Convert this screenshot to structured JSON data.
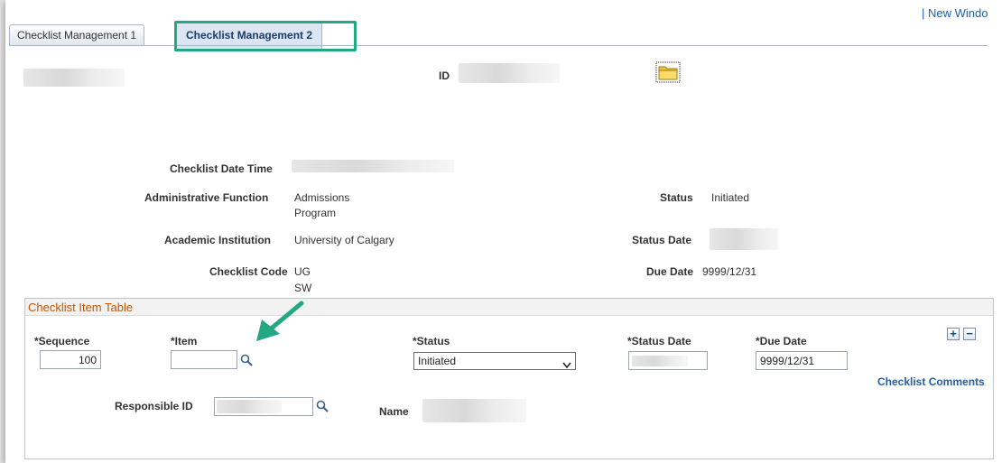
{
  "top_link": "| New Windo",
  "tabs": [
    {
      "label": "Checklist Management 1"
    },
    {
      "label": "Checklist Management 2"
    }
  ],
  "header": {
    "id_label": "ID",
    "folder_icon": "folder-icon"
  },
  "details": {
    "checklist_datetime_label": "Checklist Date Time",
    "admin_function_label": "Administrative Function",
    "admin_function_value_1": "Admissions",
    "admin_function_value_2": "Program",
    "status_label": "Status",
    "status_value": "Initiated",
    "academic_institution_label": "Academic Institution",
    "academic_institution_value": "University of Calgary",
    "status_date_label": "Status Date",
    "checklist_code_label": "Checklist Code",
    "checklist_code_value_1": "UG",
    "checklist_code_value_2": "SW",
    "due_date_label": "Due Date",
    "due_date_value": "9999/12/31"
  },
  "item_table": {
    "title": "Checklist Item Table",
    "sequence_label": "*Sequence",
    "sequence_value": "100",
    "item_label": "*Item",
    "item_value": "",
    "status_label": "*Status",
    "status_value": "Initiated",
    "status_date_label": "*Status Date",
    "due_date_label": "*Due Date",
    "due_date_value": "9999/12/31",
    "add_row": "+",
    "delete_row": "−",
    "comments_link": "Checklist Comments",
    "responsible_id_label": "Responsible ID",
    "name_label": "Name"
  },
  "colors": {
    "accent_highlight": "#23a883",
    "group_title": "#c15500",
    "link": "#1f5fa8"
  }
}
